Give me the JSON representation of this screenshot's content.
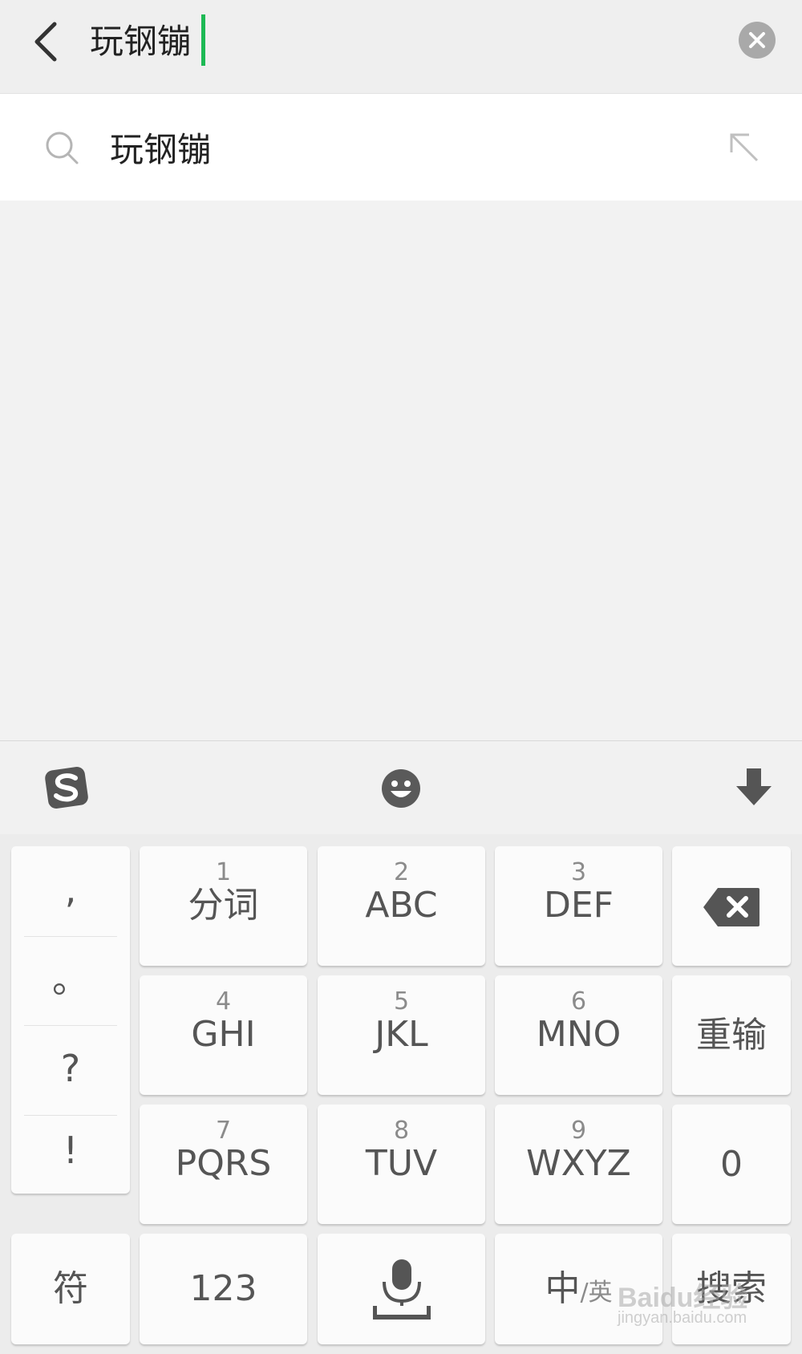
{
  "search_bar": {
    "query": "玩钢镚",
    "back_icon": "chevron-left-icon",
    "clear_icon": "close-circle-icon",
    "caret_color": "#1db954"
  },
  "suggestion": {
    "text": "玩钢镚",
    "icon": "search-icon",
    "fill_icon": "arrow-up-left-icon"
  },
  "keyboard_toolbar": {
    "logo_icon": "sogou-logo-icon",
    "emoji_icon": "emoji-icon",
    "hide_icon": "arrow-down-icon"
  },
  "keyboard": {
    "punctuation": [
      ",",
      "。",
      "?",
      "!"
    ],
    "keys": [
      {
        "num": "1",
        "label": "分词"
      },
      {
        "num": "2",
        "label": "ABC"
      },
      {
        "num": "3",
        "label": "DEF"
      },
      {
        "num": "4",
        "label": "GHI"
      },
      {
        "num": "5",
        "label": "JKL"
      },
      {
        "num": "6",
        "label": "MNO"
      },
      {
        "num": "7",
        "label": "PQRS"
      },
      {
        "num": "8",
        "label": "TUV"
      },
      {
        "num": "9",
        "label": "WXYZ"
      }
    ],
    "backspace_icon": "backspace-icon",
    "retype_label": "重输",
    "zero_label": "0",
    "symbol_label": "符",
    "numeric_label": "123",
    "mic_icon": "microphone-icon",
    "lang_main": "中",
    "lang_sub": "/英",
    "search_label": "搜索"
  },
  "watermark": {
    "text": "Baidu经验",
    "sub": "jingyan.baidu.com"
  }
}
